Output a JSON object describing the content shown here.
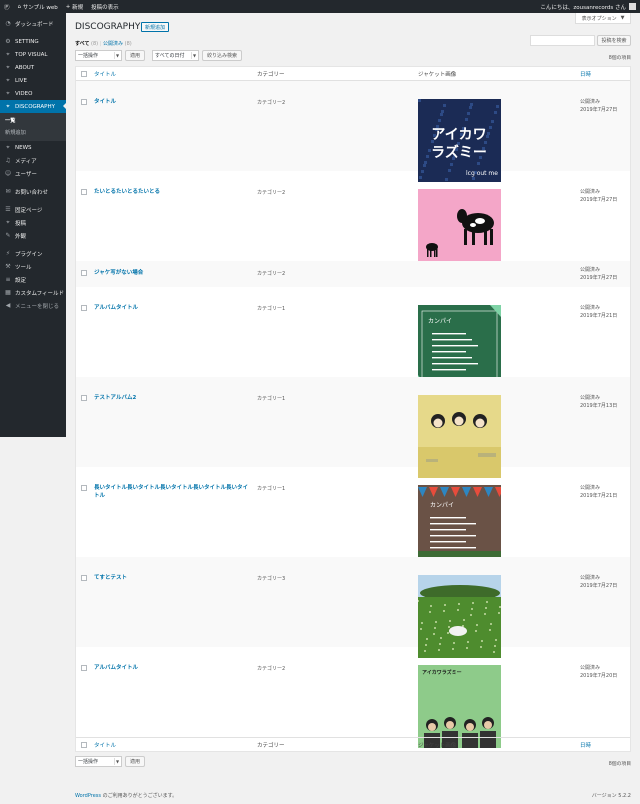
{
  "adminbar": {
    "site_name": "サンプル web",
    "new_label": "新規",
    "view_posts": "投稿の表示",
    "greeting": "こんにちは、zousanrecords さん"
  },
  "sidebar": {
    "dashboard": "ダッシュボード",
    "items": [
      {
        "label": "SETTING",
        "icon": "gear-icon"
      },
      {
        "label": "TOP VISUAL",
        "icon": "pin-icon"
      },
      {
        "label": "ABOUT",
        "icon": "pin-icon"
      },
      {
        "label": "LIVE",
        "icon": "pin-icon"
      },
      {
        "label": "VIDEO",
        "icon": "pin-icon"
      },
      {
        "label": "DISCOGRAPHY",
        "icon": "pin-icon"
      }
    ],
    "sub_items": [
      "一覧",
      "新規追加"
    ],
    "items2": [
      {
        "label": "NEWS",
        "icon": "pin-icon"
      },
      {
        "label": "メディア",
        "icon": "media-icon"
      },
      {
        "label": "ユーザー",
        "icon": "user-icon"
      }
    ],
    "items3": [
      {
        "label": "お問い合わせ",
        "icon": "mail-icon"
      }
    ],
    "items4": [
      {
        "label": "固定ページ",
        "icon": "page-icon"
      },
      {
        "label": "投稿",
        "icon": "pin-icon"
      },
      {
        "label": "外観",
        "icon": "brush-icon"
      }
    ],
    "items5": [
      {
        "label": "プラグイン",
        "icon": "plug-icon"
      },
      {
        "label": "ツール",
        "icon": "wrench-icon"
      },
      {
        "label": "設定",
        "icon": "settings-icon"
      },
      {
        "label": "カスタムフィールド",
        "icon": "grid-icon"
      }
    ],
    "collapse": "メニューを閉じる"
  },
  "screen_options": "表示オプション",
  "page": {
    "title": "DISCOGRAPHY",
    "add_new": "新規追加",
    "filter_all": "すべて",
    "filter_all_count": "(8)",
    "filter_published": "公開済み",
    "filter_published_count": "(8)",
    "search_button": "投稿を検索",
    "bulk_action": "一括操作",
    "apply": "適用",
    "all_dates": "すべての日付",
    "filter_button": "絞り込み検索",
    "item_count": "8個の項目"
  },
  "columns": {
    "title": "タイトル",
    "category": "カテゴリー",
    "jacket": "ジャケット画像",
    "date": "日時"
  },
  "rows": [
    {
      "title": "タイトル",
      "category": "カテゴリー2",
      "status": "公開済み",
      "date": "2019年7月27日",
      "jacket": "aikawa"
    },
    {
      "title": "たいとるたいとるたいとる",
      "category": "カテゴリー2",
      "status": "公開済み",
      "date": "2019年7月27日",
      "jacket": "cow"
    },
    {
      "title": "ジャケ写がない場合",
      "category": "カテゴリー2",
      "status": "公開済み",
      "date": "2019年7月27日",
      "jacket": ""
    },
    {
      "title": "アルバムタイトル",
      "category": "カテゴリー1",
      "status": "公開済み",
      "date": "2019年7月21日",
      "jacket": "kanpai"
    },
    {
      "title": "テストアルバム2",
      "category": "カテゴリー1",
      "status": "公開済み",
      "date": "2019年7月13日",
      "jacket": "trio"
    },
    {
      "title": "長いタイトル長いタイトル長いタイトル長いタイトル長いタイトル",
      "category": "カテゴリー1",
      "status": "公開済み",
      "date": "2019年7月21日",
      "jacket": "flags"
    },
    {
      "title": "てすとテスト",
      "category": "カテゴリー3",
      "status": "公開済み",
      "date": "2019年7月27日",
      "jacket": "field"
    },
    {
      "title": "アルバムタイトル",
      "category": "カテゴリー2",
      "status": "公開済み",
      "date": "2019年7月20日",
      "jacket": "band"
    }
  ],
  "jacket_text": {
    "aikawa_big": "アイカワ\nラズミー",
    "aikawa_small": "lcg out me",
    "kanpai_head": "カンパイ",
    "flags_head": "カンパイ",
    "band_head": "アイカワラズミー"
  },
  "footer": {
    "credit_link": "WordPress",
    "credit_rest": " のご利用ありがとうございます。",
    "version": "バージョン 5.2.2"
  }
}
